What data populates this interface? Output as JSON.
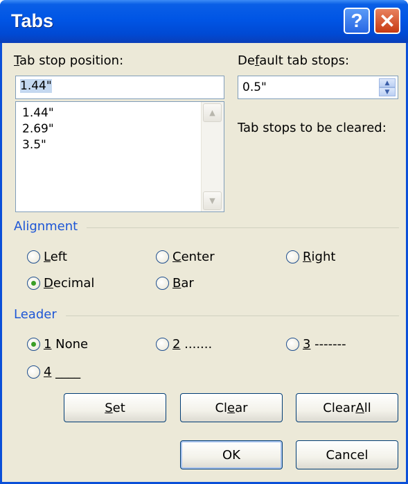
{
  "window": {
    "title": "Tabs",
    "help_label": "?",
    "close_label": "✕"
  },
  "tab_stop_position": {
    "label_mn": "T",
    "label_rest": "ab stop position:",
    "value": "1.44\"",
    "list": [
      "1.44\"",
      "2.69\"",
      "3.5\""
    ]
  },
  "default_tab_stops": {
    "label_pre": "De",
    "label_mn": "f",
    "label_post": "ault tab stops:",
    "value": "0.5\""
  },
  "cleared_label": "Tab stops to be cleared:",
  "alignment": {
    "title": "Alignment",
    "options": [
      {
        "mn": "L",
        "rest": "eft",
        "selected": false
      },
      {
        "mn": "C",
        "rest": "enter",
        "selected": false
      },
      {
        "mn": "R",
        "rest": "ight",
        "selected": false
      },
      {
        "mn": "D",
        "rest": "ecimal",
        "selected": true
      },
      {
        "mn": "B",
        "rest": "ar",
        "selected": false
      }
    ]
  },
  "leader": {
    "title": "Leader",
    "options": [
      {
        "mn": "1",
        "rest": " None",
        "selected": true
      },
      {
        "mn": "2",
        "rest": " .......",
        "selected": false
      },
      {
        "mn": "3",
        "rest": " -------",
        "selected": false
      },
      {
        "mn": "4",
        "rest": " ____",
        "selected": false
      }
    ]
  },
  "buttons": {
    "set": {
      "mn": "S",
      "rest": "et"
    },
    "clear": {
      "pre": "Cl",
      "mn": "e",
      "post": "ar"
    },
    "clear_all": {
      "pre": "Clear ",
      "mn": "A",
      "post": "ll"
    },
    "ok": "OK",
    "cancel": "Cancel"
  },
  "icons": {
    "scroll_up": "▲",
    "scroll_down": "▼",
    "spin_up": "▲",
    "spin_down": "▼"
  },
  "colors": {
    "title_bar": "#0055e5",
    "group_title": "#1d56d6",
    "dialog_bg": "#ece9d8",
    "radio_dot": "#3a9e26"
  }
}
